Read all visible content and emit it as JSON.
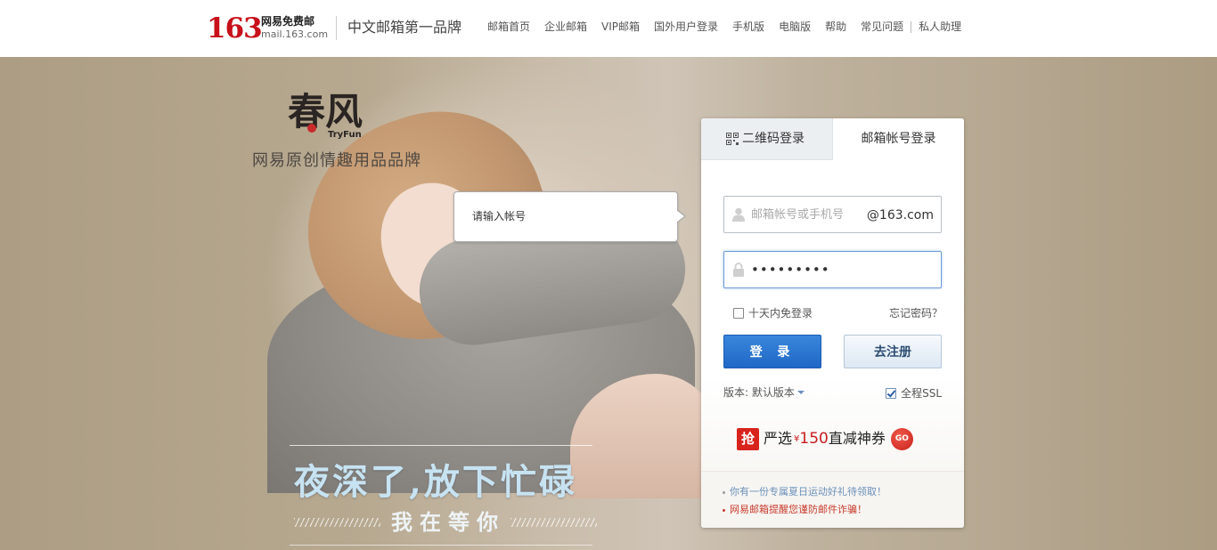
{
  "header": {
    "logo_number": "163",
    "logo_cn": "网易免费邮",
    "logo_domain": "mail.163.com",
    "slogan": "中文邮箱第一品牌",
    "nav": [
      {
        "label": "邮箱首页"
      },
      {
        "label": "企业邮箱"
      },
      {
        "label": "VIP邮箱"
      },
      {
        "label": "国外用户登录"
      },
      {
        "label": "手机版"
      },
      {
        "label": "电脑版"
      },
      {
        "label": "帮助"
      },
      {
        "label": "常见问题"
      },
      {
        "label": "私人助理"
      }
    ]
  },
  "hero": {
    "brand_logo_text": "春风",
    "brand_logo_en": "TryFun",
    "brand_name": "网易原创情趣用品品牌",
    "title": "夜深了,放下忙碌",
    "subtitle": "我在等你"
  },
  "tooltip": {
    "text": "请输入帐号"
  },
  "login": {
    "tab_qr": "二维码登录",
    "tab_account": "邮箱帐号登录",
    "username_placeholder": "邮箱帐号或手机号",
    "domain_suffix": "@163.com",
    "password_value": "•••••••••",
    "remember_label": "十天内免登录",
    "remember_checked": false,
    "forgot_label": "忘记密码？",
    "login_button": "登 录",
    "register_button": "去注册",
    "version_label": "版本: 默认版本",
    "ssl_label": "全程SSL",
    "ssl_checked": true,
    "promo": {
      "badge": "抢",
      "text_1": "严选",
      "yen": "¥",
      "amount": "150",
      "text_2": "直减神券",
      "go": "GO"
    },
    "notices": [
      {
        "text": "你有一份专属夏日运动好礼待领取！",
        "color": "#6b8fb9"
      },
      {
        "text": "网易邮箱提醒您谨防邮件诈骗！",
        "color": "#c83b2c"
      }
    ]
  },
  "colors": {
    "brand_red": "#c8101a",
    "login_button_blue": "#1f68c6",
    "background": "#b0a189"
  }
}
